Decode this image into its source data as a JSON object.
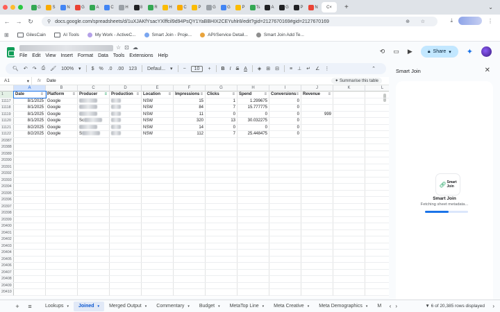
{
  "browser": {
    "tab_letters": [
      "G",
      "S",
      "N",
      "G",
      "A",
      "C",
      "H",
      "8",
      "R",
      "H",
      "C",
      "P",
      "G",
      "G",
      "P",
      "Ts",
      "A",
      "G",
      "P",
      "N"
    ],
    "active_tab_letter": "C",
    "url": "docs.google.com/spreadsheets/d/1uXJAKfYsacYXlffcil9d94PsQY1YaBBHIX2CEYuhlr8/edit?gid=2127670169#gid=2127670169",
    "bookmarks": [
      "GilesCain",
      "AI Tools",
      "My Work - ActiveC...",
      "Smart Join - Proje...",
      "API/Service Detail...",
      "Smart Join Add Te..."
    ]
  },
  "menu": [
    "File",
    "Edit",
    "View",
    "Insert",
    "Format",
    "Data",
    "Tools",
    "Extensions",
    "Help"
  ],
  "share_label": "Share",
  "toolbar": {
    "zoom": "100%",
    "currency": "$",
    "percent": "%",
    "dec_decrease": ".0",
    "dec_increase": ".00",
    "number_format": "123",
    "font": "Defaul...",
    "font_size": "10"
  },
  "formula_bar": {
    "cell_ref": "A1",
    "fx_label": "fx",
    "content": "Date",
    "summarise_label": "Summarise this table"
  },
  "columns": [
    "A",
    "B",
    "C",
    "D",
    "E",
    "F",
    "G",
    "H",
    "I",
    "J",
    "K",
    "L"
  ],
  "table": {
    "header_row_num": "1",
    "headers": [
      "Date",
      "Platform",
      "Producer",
      "Production",
      "Location",
      "Impressions",
      "Clicks",
      "Spend",
      "Conversions",
      "Revenue"
    ],
    "rows": [
      {
        "num": "11117",
        "date": "8/1/2025",
        "platform": "Google",
        "producer": "",
        "location": "NSW",
        "impressions": "15",
        "clicks": "1",
        "spend": "1.299675",
        "conversions": "0",
        "revenue": ""
      },
      {
        "num": "11118",
        "date": "8/1/2025",
        "platform": "Google",
        "producer": "",
        "location": "NSW",
        "impressions": "84",
        "clicks": "7",
        "spend": "15.777775",
        "conversions": "0",
        "revenue": ""
      },
      {
        "num": "11119",
        "date": "8/1/2025",
        "platform": "Google",
        "producer": "",
        "location": "NSW",
        "impressions": "11",
        "clicks": "0",
        "spend": "0",
        "conversions": "0",
        "revenue": "999"
      },
      {
        "num": "11120",
        "date": "8/1/2025",
        "platform": "Google",
        "producer": "Sc",
        "location": "NSW",
        "impressions": "320",
        "clicks": "13",
        "spend": "30.032275",
        "conversions": "0",
        "revenue": ""
      },
      {
        "num": "11121",
        "date": "8/2/2025",
        "platform": "Google",
        "producer": "",
        "location": "NSW",
        "impressions": "14",
        "clicks": "0",
        "spend": "0",
        "conversions": "0",
        "revenue": ""
      },
      {
        "num": "11122",
        "date": "8/2/2025",
        "platform": "Google",
        "producer": "S",
        "location": "NSW",
        "impressions": "112",
        "clicks": "7",
        "spend": "25.448475",
        "conversions": "0",
        "revenue": ""
      }
    ],
    "empty_rows": [
      "20387",
      "20388",
      "20389",
      "20390",
      "20391",
      "20392",
      "20393",
      "20394",
      "20395",
      "20396",
      "20397",
      "20398",
      "20399",
      "20400",
      "20401",
      "20402",
      "20403",
      "20404",
      "20405",
      "20406",
      "20407",
      "20408",
      "20409",
      "20410"
    ]
  },
  "sheet_tabs": [
    "Lookups",
    "Joined",
    "Merged Output",
    "Commentary",
    "Budget",
    "MetaTop Line",
    "Meta Creative",
    "Meta Demographics",
    "M"
  ],
  "active_sheet": "Joined",
  "row_count": "6 of 20,385 rows displayed",
  "panel": {
    "title": "Smart Join",
    "logo_line1": "Smart",
    "logo_line2": "Join",
    "app_name": "Smart Join",
    "status": "Fetching sheet metadata...",
    "progress": 0.55
  }
}
